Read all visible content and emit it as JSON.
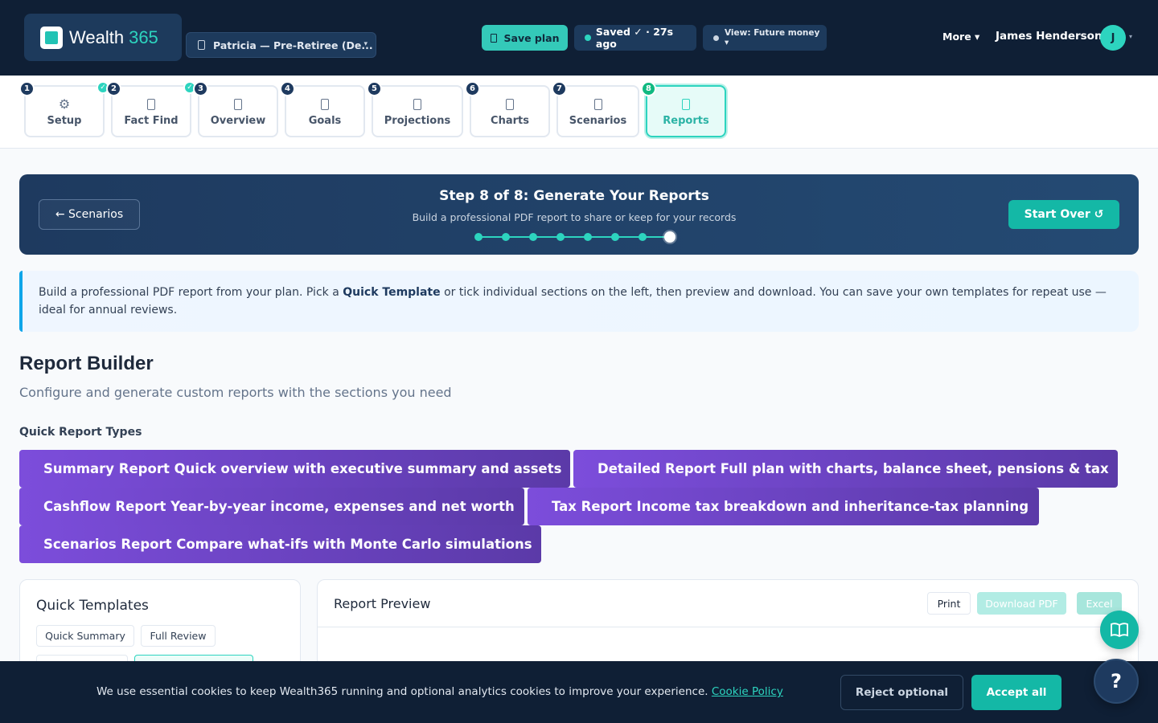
{
  "brand": {
    "name": "Wealth",
    "suffix": "365"
  },
  "client_select": {
    "value": "Patricia — Pre-Retiree (De...",
    "caret": "▾"
  },
  "toolbar": {
    "save_label": "Save plan",
    "saved_status": "Saved ✓ · 27s ago",
    "view_label": "View: Future money ▾",
    "more_label": "More ▾"
  },
  "user": {
    "name": "James Henderson",
    "initial": "J",
    "caret": "▾"
  },
  "steps": [
    {
      "num": "1",
      "label": "Setup",
      "icon": "gear-icon",
      "glyph": "⚙"
    },
    {
      "num": "2",
      "label": "Fact Find",
      "icon": "clipboard-icon",
      "check": "✓"
    },
    {
      "num": "3",
      "label": "Overview",
      "icon": "document-icon",
      "check": "✓"
    },
    {
      "num": "4",
      "label": "Goals",
      "icon": "target-icon"
    },
    {
      "num": "5",
      "label": "Projections",
      "icon": "projection-icon"
    },
    {
      "num": "6",
      "label": "Charts",
      "icon": "chart-icon"
    },
    {
      "num": "7",
      "label": "Scenarios",
      "icon": "scenario-icon"
    },
    {
      "num": "8",
      "label": "Reports",
      "icon": "report-icon"
    }
  ],
  "hero": {
    "back_label": "← Scenarios",
    "title": "Step 8 of 8: Generate Your Reports",
    "subtitle": "Build a professional PDF report to share or keep for your records",
    "progress_current": 8,
    "progress_total": 8,
    "start_over_label": "Start Over ↺"
  },
  "info": {
    "text_1": "Build a professional PDF report from your plan. Pick a ",
    "highlight": "Quick Template",
    "text_2": " or tick individual sections on the left, then preview and download. You can save your own templates for repeat use — ideal for annual reviews."
  },
  "report_builder": {
    "title": "Report Builder",
    "subtitle": "Configure and generate custom reports with the sections you need",
    "quick_types_heading": "Quick Report Types",
    "types": [
      "Summary Report Quick overview with executive summary and assets",
      "Detailed Report Full plan with charts, balance sheet, pensions & tax",
      "Cashflow Report Year-by-year income, expenses and net worth",
      "Tax Report Income tax breakdown and inheritance-tax planning",
      "Scenarios Report Compare what-ifs with Monte Carlo simulations"
    ]
  },
  "quick_templates": {
    "title": "Quick Templates",
    "chips": [
      "Quick Summary",
      "Full Review"
    ]
  },
  "preview": {
    "title": "Report Preview",
    "print": "Print",
    "download": "Download PDF",
    "excel": "Excel"
  },
  "cookie": {
    "text": "We use essential cookies to keep Wealth365 running and optional analytics cookies to improve your experience.",
    "link": "Cookie Policy",
    "reject": "Reject optional",
    "accept": "Accept all"
  },
  "help_label": "?",
  "colors": {
    "brand_teal": "#2dd4bf",
    "navy": "#0f1f35",
    "purple": "#7c4ddb"
  }
}
